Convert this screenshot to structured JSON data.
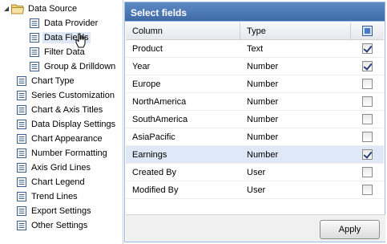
{
  "tree": {
    "root": {
      "label": "Data Source",
      "icon": "folder-icon"
    },
    "children": [
      {
        "label": "Data Provider"
      },
      {
        "label": "Data Fields",
        "selected": true
      },
      {
        "label": "Filter Data"
      },
      {
        "label": "Group & Drilldown"
      }
    ],
    "items": [
      {
        "label": "Chart Type"
      },
      {
        "label": "Series Customization"
      },
      {
        "label": "Chart & Axis Titles"
      },
      {
        "label": "Data Display Settings"
      },
      {
        "label": "Chart Appearance"
      },
      {
        "label": "Number Formatting"
      },
      {
        "label": "Axis Grid Lines"
      },
      {
        "label": "Chart Legend"
      },
      {
        "label": "Trend Lines"
      },
      {
        "label": "Export Settings"
      },
      {
        "label": "Other Settings"
      }
    ]
  },
  "panel": {
    "title": "Select fields",
    "columns": {
      "column": "Column",
      "type": "Type"
    },
    "rows": [
      {
        "column": "Product",
        "type": "Text",
        "checked": true
      },
      {
        "column": "Year",
        "type": "Number",
        "checked": true
      },
      {
        "column": "Europe",
        "type": "Number",
        "checked": false
      },
      {
        "column": "NorthAmerica",
        "type": "Number",
        "checked": false
      },
      {
        "column": "SouthAmerica",
        "type": "Number",
        "checked": false
      },
      {
        "column": "AsiaPacific",
        "type": "Number",
        "checked": false
      },
      {
        "column": "Earnings",
        "type": "Number",
        "checked": true,
        "highlighted": true
      },
      {
        "column": "Created By",
        "type": "User",
        "checked": false
      },
      {
        "column": "Modified By",
        "type": "User",
        "checked": false
      }
    ],
    "apply_label": "Apply"
  },
  "colors": {
    "header": "#4f7bbd",
    "selected": "#dfe8f6",
    "border": "#99bbe8"
  }
}
